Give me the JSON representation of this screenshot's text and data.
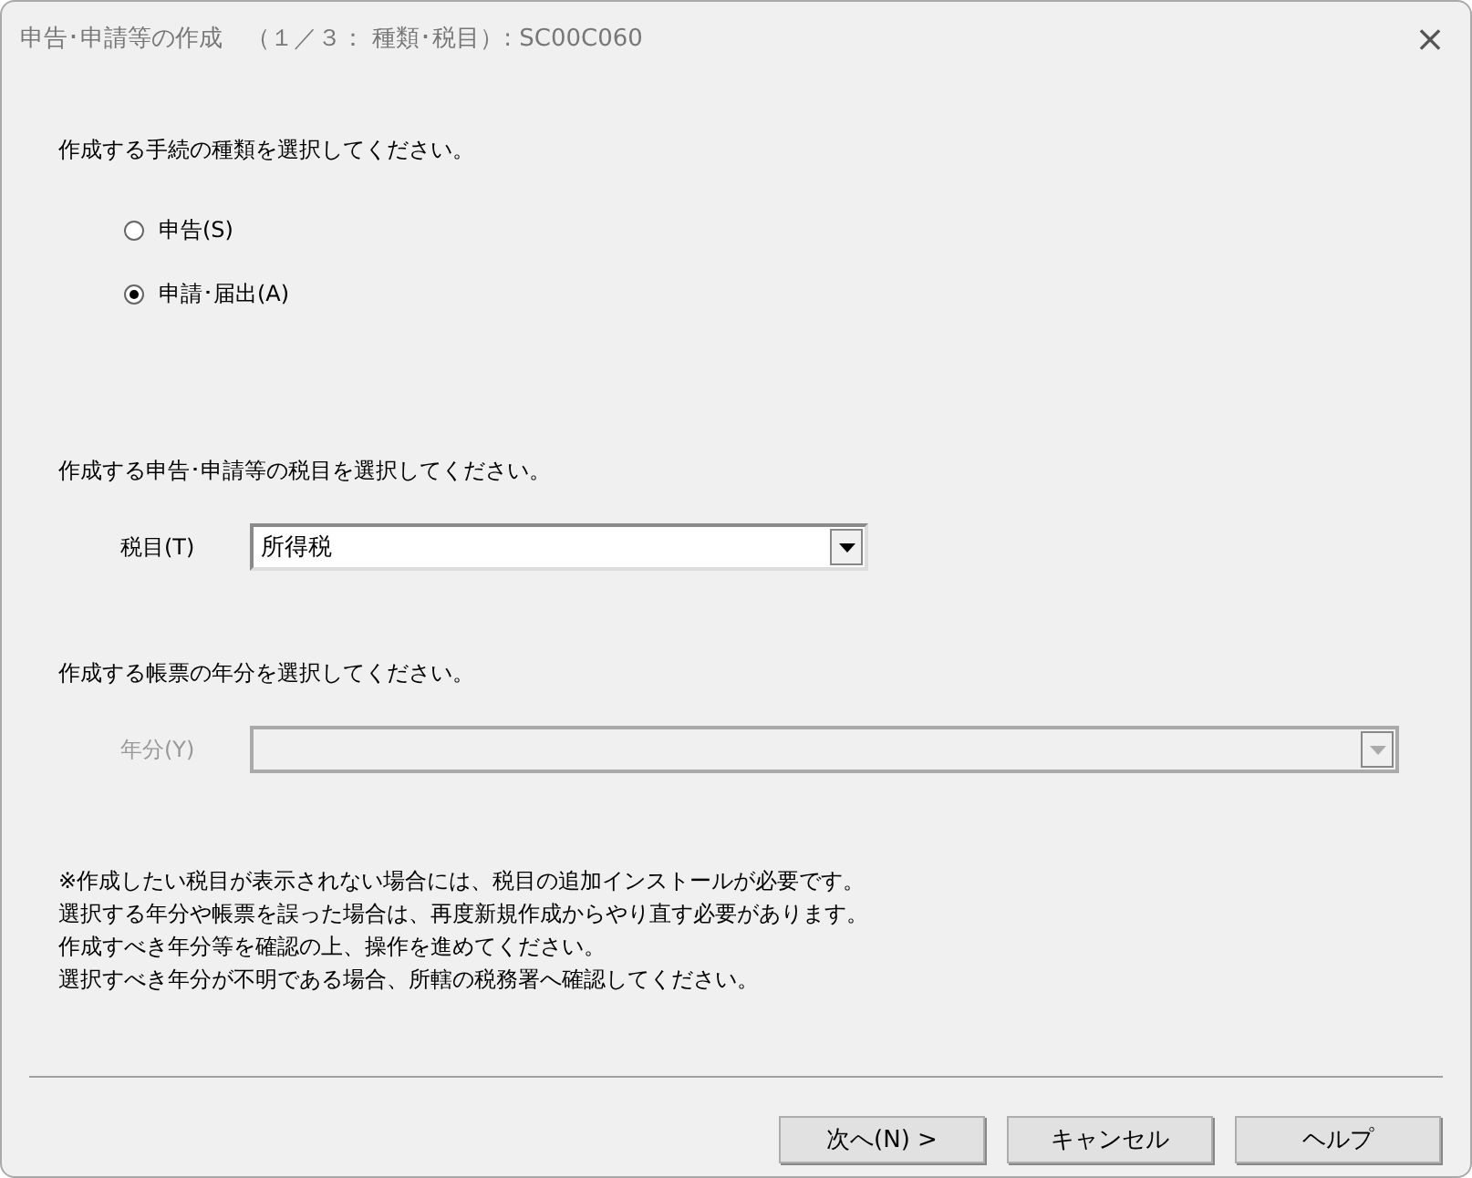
{
  "window": {
    "title": "申告･申請等の作成　（１／３： 種類･税目）: SC00C060",
    "close": "×"
  },
  "procedure": {
    "prompt": "作成する手続の種類を選択してください。",
    "options": [
      {
        "label": "申告(S)",
        "selected": false
      },
      {
        "label": "申請･届出(A)",
        "selected": true
      }
    ]
  },
  "tax_item": {
    "prompt": "作成する申告･申請等の税目を選択してください。",
    "label": "税目(T)",
    "value": "所得税",
    "disabled": false
  },
  "year": {
    "prompt": "作成する帳票の年分を選択してください。",
    "label": "年分(Y)",
    "disabled": true
  },
  "notes": [
    "※作成したい税目が表示されない場合には、税目の追加インストールが必要です。",
    "選択する年分や帳票を誤った場合は、再度新規作成からやり直す必要があります。",
    "作成すべき年分等を確認の上、操作を進めてください。",
    "選択すべき年分が不明である場合、所轄の税務署へ確認してください。"
  ],
  "buttons": [
    "次へ(N) >",
    "キャンセル",
    "ヘルプ"
  ]
}
